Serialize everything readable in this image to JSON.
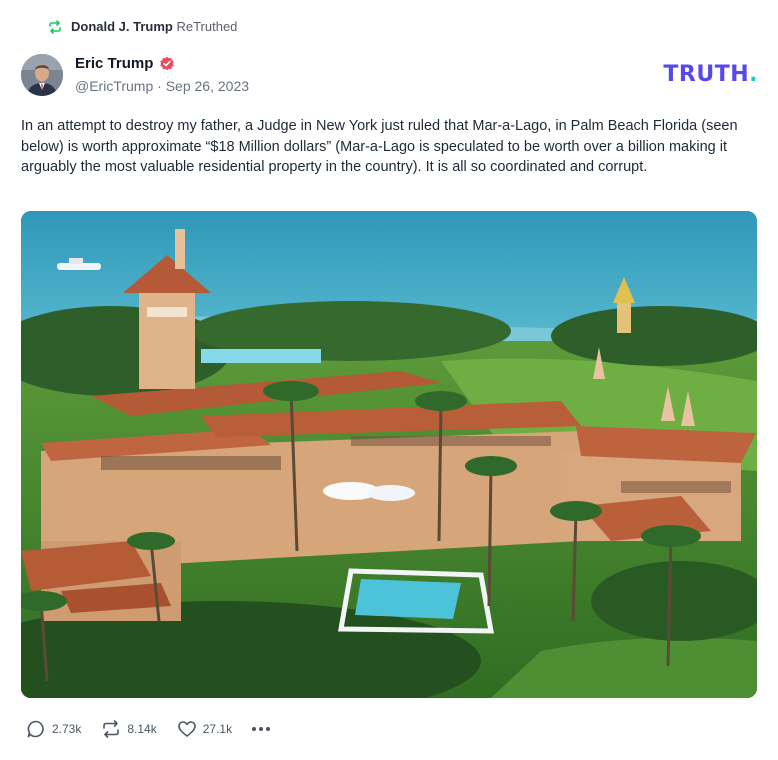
{
  "retruth": {
    "user": "Donald J. Trump",
    "label": "ReTruthed",
    "icon": "retruth-icon"
  },
  "author": {
    "name": "Eric Trump",
    "handle": "@EricTrump",
    "separator": "·",
    "date": "Sep 26, 2023",
    "verified": true
  },
  "brand": {
    "name": "TRUTH",
    "dot": ".",
    "color": "#5448ee",
    "dot_color": "#16d1c4"
  },
  "post": {
    "text": "In an attempt to destroy my father, a Judge in New York just ruled that Mar-a-Lago, in Palm Beach Florida (seen below) is worth approximate “$18 Million dollars” (Mar-a-Lago is speculated to be worth over a billion making it arguably the most valuable residential property in the country). It is all so coordinated and corrupt."
  },
  "actions": {
    "replies": "2.73k",
    "retruths": "8.14k",
    "likes": "27.1k"
  }
}
